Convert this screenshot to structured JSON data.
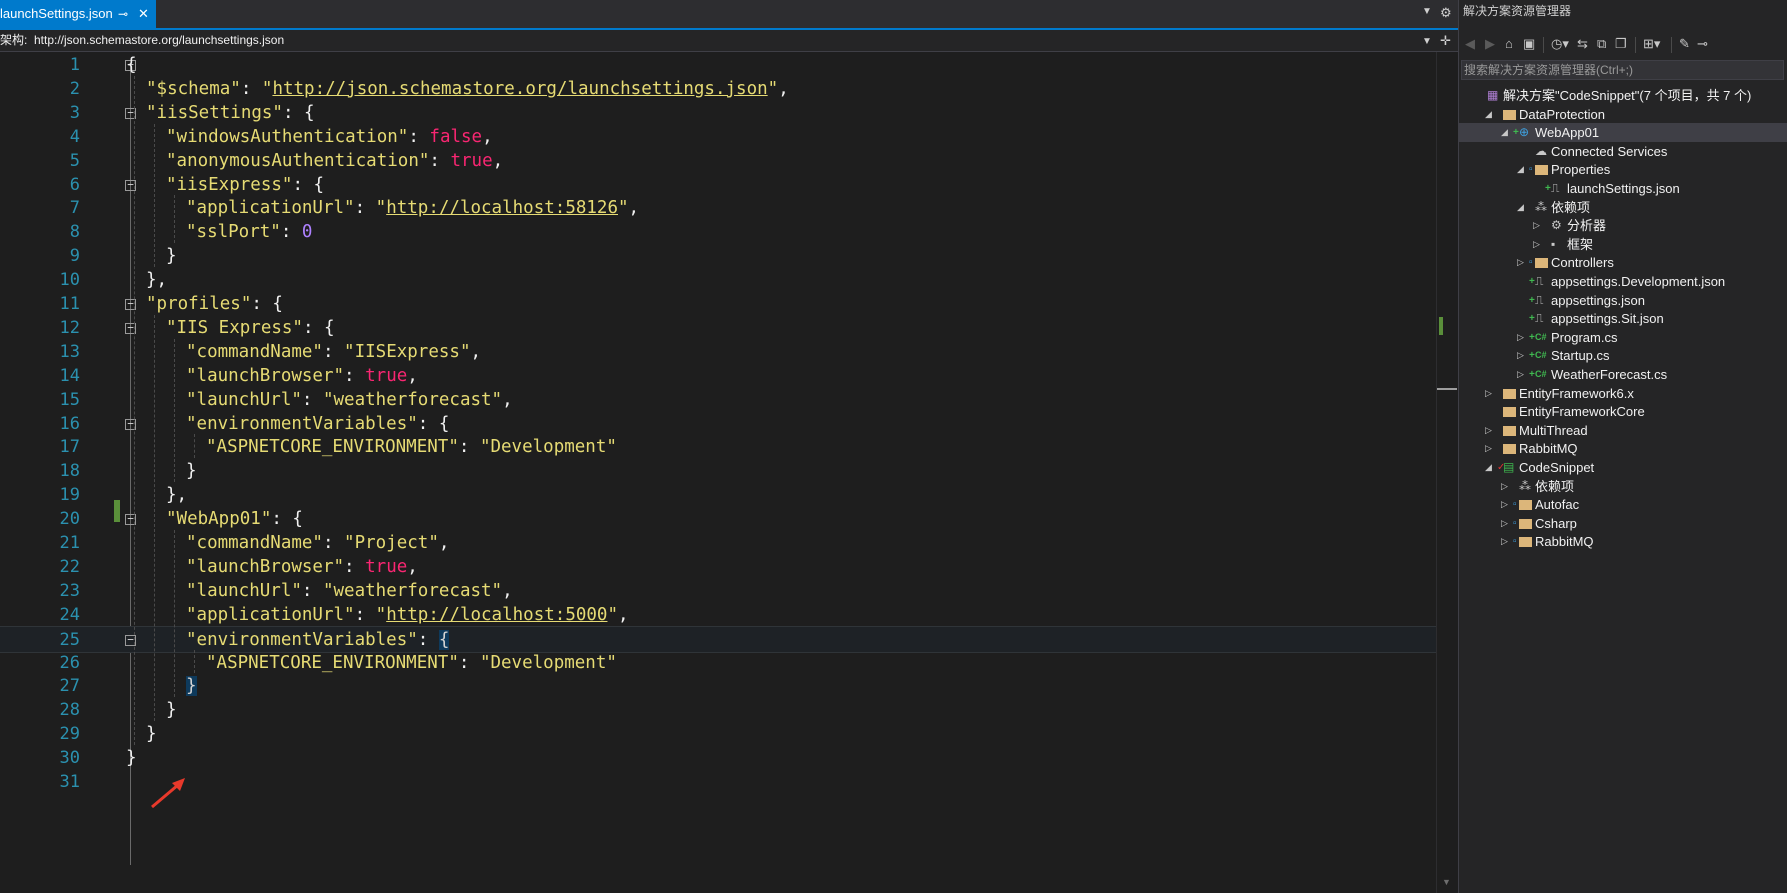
{
  "editor_tab": {
    "title": "launchSettings.json",
    "pin": "⊸",
    "close": "✕"
  },
  "schema_bar": {
    "label": "架构:",
    "value": "http://json.schemastore.org/launchsettings.json"
  },
  "line_numbers": [
    "1",
    "2",
    "3",
    "4",
    "5",
    "6",
    "7",
    "8",
    "9",
    "10",
    "11",
    "12",
    "13",
    "14",
    "15",
    "16",
    "17",
    "18",
    "19",
    "20",
    "21",
    "22",
    "23",
    "24",
    "25",
    "26",
    "27",
    "28",
    "29",
    "30",
    "31"
  ],
  "code_lines": [
    [
      {
        "t": "{",
        "c": "p"
      }
    ],
    [
      {
        "t": "\"$schema\"",
        "c": "k"
      },
      {
        "t": ": ",
        "c": "p"
      },
      {
        "t": "\"",
        "c": "s"
      },
      {
        "t": "http://json.schemastore.org/launchsettings.json",
        "c": "url"
      },
      {
        "t": "\"",
        "c": "s"
      },
      {
        "t": ",",
        "c": "p"
      }
    ],
    [
      {
        "t": "\"iisSettings\"",
        "c": "k"
      },
      {
        "t": ": {",
        "c": "p"
      }
    ],
    [
      {
        "t": "\"windowsAuthentication\"",
        "c": "k"
      },
      {
        "t": ": ",
        "c": "p"
      },
      {
        "t": "false",
        "c": "bool"
      },
      {
        "t": ",",
        "c": "p"
      }
    ],
    [
      {
        "t": "\"anonymousAuthentication\"",
        "c": "k"
      },
      {
        "t": ": ",
        "c": "p"
      },
      {
        "t": "true",
        "c": "bool"
      },
      {
        "t": ",",
        "c": "p"
      }
    ],
    [
      {
        "t": "\"iisExpress\"",
        "c": "k"
      },
      {
        "t": ": {",
        "c": "p"
      }
    ],
    [
      {
        "t": "\"applicationUrl\"",
        "c": "k"
      },
      {
        "t": ": ",
        "c": "p"
      },
      {
        "t": "\"",
        "c": "s"
      },
      {
        "t": "http://localhost:58126",
        "c": "url"
      },
      {
        "t": "\"",
        "c": "s"
      },
      {
        "t": ",",
        "c": "p"
      }
    ],
    [
      {
        "t": "\"sslPort\"",
        "c": "k"
      },
      {
        "t": ": ",
        "c": "p"
      },
      {
        "t": "0",
        "c": "num"
      }
    ],
    [
      {
        "t": "}",
        "c": "p"
      }
    ],
    [
      {
        "t": "},",
        "c": "p"
      }
    ],
    [
      {
        "t": "\"profiles\"",
        "c": "k"
      },
      {
        "t": ": {",
        "c": "p"
      }
    ],
    [
      {
        "t": "\"IIS Express\"",
        "c": "k"
      },
      {
        "t": ": {",
        "c": "p"
      }
    ],
    [
      {
        "t": "\"commandName\"",
        "c": "k"
      },
      {
        "t": ": ",
        "c": "p"
      },
      {
        "t": "\"IISExpress\"",
        "c": "s"
      },
      {
        "t": ",",
        "c": "p"
      }
    ],
    [
      {
        "t": "\"launchBrowser\"",
        "c": "k"
      },
      {
        "t": ": ",
        "c": "p"
      },
      {
        "t": "true",
        "c": "bool"
      },
      {
        "t": ",",
        "c": "p"
      }
    ],
    [
      {
        "t": "\"launchUrl\"",
        "c": "k"
      },
      {
        "t": ": ",
        "c": "p"
      },
      {
        "t": "\"weatherforecast\"",
        "c": "s"
      },
      {
        "t": ",",
        "c": "p"
      }
    ],
    [
      {
        "t": "\"environmentVariables\"",
        "c": "k"
      },
      {
        "t": ": {",
        "c": "p"
      }
    ],
    [
      {
        "t": "\"ASPNETCORE_ENVIRONMENT\"",
        "c": "k"
      },
      {
        "t": ": ",
        "c": "p"
      },
      {
        "t": "\"Development\"",
        "c": "s"
      }
    ],
    [
      {
        "t": "}",
        "c": "p"
      }
    ],
    [
      {
        "t": "},",
        "c": "p"
      }
    ],
    [
      {
        "t": "\"WebApp01\"",
        "c": "k"
      },
      {
        "t": ": {",
        "c": "p"
      }
    ],
    [
      {
        "t": "\"commandName\"",
        "c": "k"
      },
      {
        "t": ": ",
        "c": "p"
      },
      {
        "t": "\"Project\"",
        "c": "s"
      },
      {
        "t": ",",
        "c": "p"
      }
    ],
    [
      {
        "t": "\"launchBrowser\"",
        "c": "k"
      },
      {
        "t": ": ",
        "c": "p"
      },
      {
        "t": "true",
        "c": "bool"
      },
      {
        "t": ",",
        "c": "p"
      }
    ],
    [
      {
        "t": "\"launchUrl\"",
        "c": "k"
      },
      {
        "t": ": ",
        "c": "p"
      },
      {
        "t": "\"weatherforecast\"",
        "c": "s"
      },
      {
        "t": ",",
        "c": "p"
      }
    ],
    [
      {
        "t": "\"applicationUrl\"",
        "c": "k"
      },
      {
        "t": ": ",
        "c": "p"
      },
      {
        "t": "\"",
        "c": "s"
      },
      {
        "t": "http://localhost:5000",
        "c": "url"
      },
      {
        "t": "\"",
        "c": "s"
      },
      {
        "t": ",",
        "c": "p"
      }
    ],
    [
      {
        "t": "\"environmentVariables\"",
        "c": "k"
      },
      {
        "t": ": ",
        "c": "p"
      },
      {
        "t": "{",
        "c": "brace-hl"
      }
    ],
    [
      {
        "t": "\"ASPNETCORE_ENVIRONMENT\"",
        "c": "k"
      },
      {
        "t": ": ",
        "c": "p"
      },
      {
        "t": "\"Development\"",
        "c": "s"
      }
    ],
    [
      {
        "t": "}",
        "c": "brace-hl"
      }
    ],
    [
      {
        "t": "}",
        "c": "p"
      }
    ],
    [
      {
        "t": "}",
        "c": "p"
      }
    ],
    [
      {
        "t": "}",
        "c": "p"
      }
    ],
    []
  ],
  "solution_explorer": {
    "title": "解决方案资源管理器",
    "search_placeholder": "搜索解决方案资源管理器(Ctrl+;)",
    "items": [
      {
        "label": "解决方案\"CodeSnippet\"(7 个项目，共 7 个)",
        "icon": "solution-icon"
      },
      {
        "label": "DataProtection",
        "icon": "folder-icon"
      },
      {
        "label": "WebApp01",
        "icon": "web-project-icon"
      },
      {
        "label": "Connected Services",
        "icon": "connected-services-icon"
      },
      {
        "label": "Properties",
        "icon": "properties-folder-icon"
      },
      {
        "label": "launchSettings.json",
        "icon": "json-file-icon"
      },
      {
        "label": "依赖项",
        "icon": "dependencies-icon"
      },
      {
        "label": "分析器",
        "icon": "analyzer-icon"
      },
      {
        "label": "框架",
        "icon": "framework-icon"
      },
      {
        "label": "Controllers",
        "icon": "folder-icon"
      },
      {
        "label": "appsettings.Development.json",
        "icon": "json-file-icon"
      },
      {
        "label": "appsettings.json",
        "icon": "json-file-icon"
      },
      {
        "label": "appsettings.Sit.json",
        "icon": "json-file-icon"
      },
      {
        "label": "Program.cs",
        "icon": "csharp-file-icon"
      },
      {
        "label": "Startup.cs",
        "icon": "csharp-file-icon"
      },
      {
        "label": "WeatherForecast.cs",
        "icon": "csharp-file-icon"
      },
      {
        "label": "EntityFramework6.x",
        "icon": "folder-icon"
      },
      {
        "label": "EntityFrameworkCore",
        "icon": "folder-icon"
      },
      {
        "label": "MultiThread",
        "icon": "folder-icon"
      },
      {
        "label": "RabbitMQ",
        "icon": "folder-icon"
      },
      {
        "label": "CodeSnippet",
        "icon": "console-project-icon"
      },
      {
        "label": "依赖项",
        "icon": "dependencies-icon"
      },
      {
        "label": "Autofac",
        "icon": "folder-icon"
      },
      {
        "label": "Csharp",
        "icon": "folder-icon"
      },
      {
        "label": "RabbitMQ",
        "icon": "folder-icon"
      }
    ]
  },
  "colors": {
    "accent": "#007acc",
    "key": "#e6db74",
    "bool": "#f92672",
    "number": "#ae81ff",
    "line_number": "#2b91af",
    "arrow": "#e8392b"
  }
}
